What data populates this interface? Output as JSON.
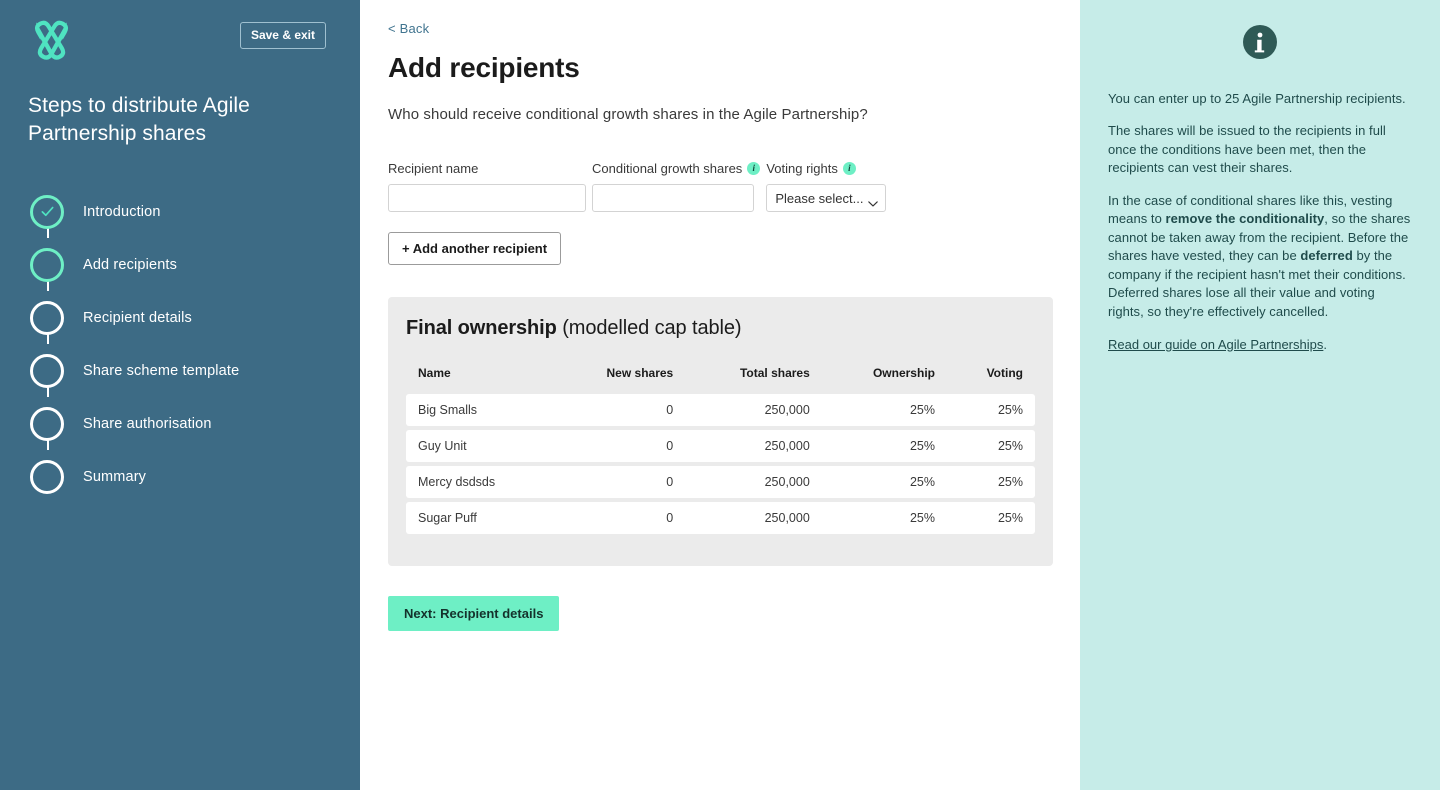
{
  "sidebar": {
    "logo_name": "vestd-logo",
    "save_exit_label": "Save & exit",
    "title": "Steps to distribute Agile Partnership shares",
    "steps": [
      {
        "label": "Introduction",
        "state": "done"
      },
      {
        "label": "Add recipients",
        "state": "current"
      },
      {
        "label": "Recipient details",
        "state": "todo"
      },
      {
        "label": "Share scheme template",
        "state": "todo"
      },
      {
        "label": "Share authorisation",
        "state": "todo"
      },
      {
        "label": "Summary",
        "state": "todo"
      }
    ]
  },
  "main": {
    "back_label": "< Back",
    "title": "Add recipients",
    "subtitle": "Who should receive conditional growth shares in the Agile Partnership?",
    "form": {
      "recipient_name_label": "Recipient name",
      "recipient_name_value": "",
      "recipient_name_placeholder": "",
      "conditional_shares_label": "Conditional growth shares",
      "conditional_shares_value": "",
      "conditional_shares_placeholder": "",
      "voting_rights_label": "Voting rights",
      "voting_rights_selected": "Please select...",
      "voting_rights_options": [
        "Please select..."
      ],
      "info_badge_glyph": "i",
      "add_recipient_label": "+ Add another recipient"
    },
    "cap_table": {
      "title_strong": "Final ownership",
      "title_light": "(modelled cap table)",
      "columns": [
        "Name",
        "New shares",
        "Total shares",
        "Ownership",
        "Voting"
      ],
      "rows": [
        {
          "name": "Big Smalls",
          "new_shares": "0",
          "total_shares": "250,000",
          "ownership": "25%",
          "voting": "25%"
        },
        {
          "name": "Guy Unit",
          "new_shares": "0",
          "total_shares": "250,000",
          "ownership": "25%",
          "voting": "25%"
        },
        {
          "name": "Mercy dsdsds",
          "new_shares": "0",
          "total_shares": "250,000",
          "ownership": "25%",
          "voting": "25%"
        },
        {
          "name": "Sugar Puff",
          "new_shares": "0",
          "total_shares": "250,000",
          "ownership": "25%",
          "voting": "25%"
        }
      ]
    },
    "next_label": "Next: Recipient details"
  },
  "info_panel": {
    "icon_name": "info-circle-icon",
    "paragraph_1": "You can enter up to 25 Agile Partnership recipients.",
    "paragraph_2": "The shares will be issued to the recipients in full once the conditions have been met, then the recipients can vest their shares.",
    "paragraph_3_a": "In the case of conditional shares like this, vesting means to ",
    "paragraph_3_b": "remove the conditionality",
    "paragraph_3_c": ", so the shares cannot be taken away from the recipient. Before the shares have vested, they can be ",
    "paragraph_3_d": "deferred",
    "paragraph_3_e": " by the company if the recipient hasn't met their conditions. Deferred shares lose all their value and voting rights, so they're effectively cancelled.",
    "link_label": "Read our guide on Agile Partnerships",
    "link_suffix": "."
  },
  "colors": {
    "sidebar_bg": "#3D6B85",
    "accent_mint": "#6EEFC5",
    "info_panel_bg": "#C6ECE8",
    "info_text": "#1F4B4B",
    "card_bg": "#EBEBEB",
    "back_link": "#40748F"
  }
}
